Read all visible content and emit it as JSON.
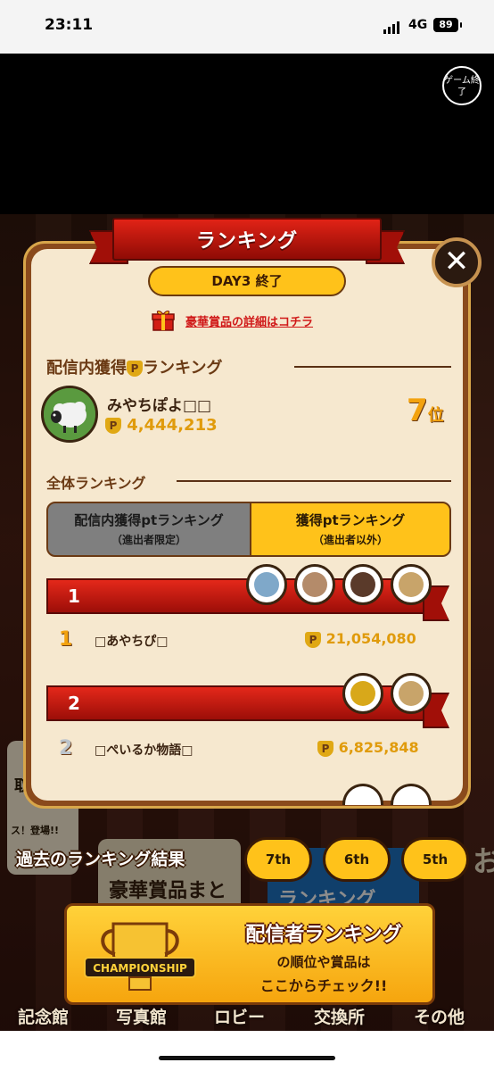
{
  "status_bar": {
    "time": "23:11",
    "network": "4G",
    "battery": "89"
  },
  "end_game_button": "ゲーム終了",
  "background": {
    "left_card_text": "取れ。",
    "left_card_sub": "ス！登場!!",
    "center_card_text": "豪華賞品まとめ",
    "right_card_text": "ランキング",
    "right_edge_text": "お"
  },
  "bottom_nav": [
    "記念館",
    "写真館",
    "ロビー",
    "交換所",
    "その他"
  ],
  "modal": {
    "title": "ランキング",
    "day_status": "DAY3 終了",
    "prize_link": "豪華賞品の詳細はコチラ",
    "in_stream_section": "配信内獲得",
    "in_stream_section_suffix": "ランキング",
    "me": {
      "name": "みやちぽよ□□",
      "points": "4,444,213",
      "rank": "7",
      "rank_unit": "位"
    },
    "overall_section": "全体ランキング",
    "tabs": [
      {
        "line1": "配信内獲得ptランキング",
        "line2": "（進出者限定）",
        "selected": false
      },
      {
        "line1": "獲得ptランキング",
        "line2": "（進出者以外）",
        "selected": true
      }
    ],
    "rankings": [
      {
        "bar_num": "1",
        "rank": "1",
        "name": "□あやちぴ□",
        "points": "21,054,080"
      },
      {
        "bar_num": "2",
        "rank": "2",
        "name": "□ぺいるか物語□",
        "points": "6,825,848"
      }
    ]
  },
  "past_results": {
    "label": "過去のランキング結果",
    "buttons": [
      "7th",
      "6th",
      "5th"
    ]
  },
  "promo": {
    "logo_text": "CHAMPIONSHIP",
    "line1": "配信者ランキング",
    "line2": "の順位や賞品は",
    "line3": "ここからチェック!!"
  },
  "colors": {
    "accent_gold": "#ffc21a",
    "banner_red": "#d61f14",
    "link_red": "#d01818",
    "points_gold": "#e09b0c"
  }
}
